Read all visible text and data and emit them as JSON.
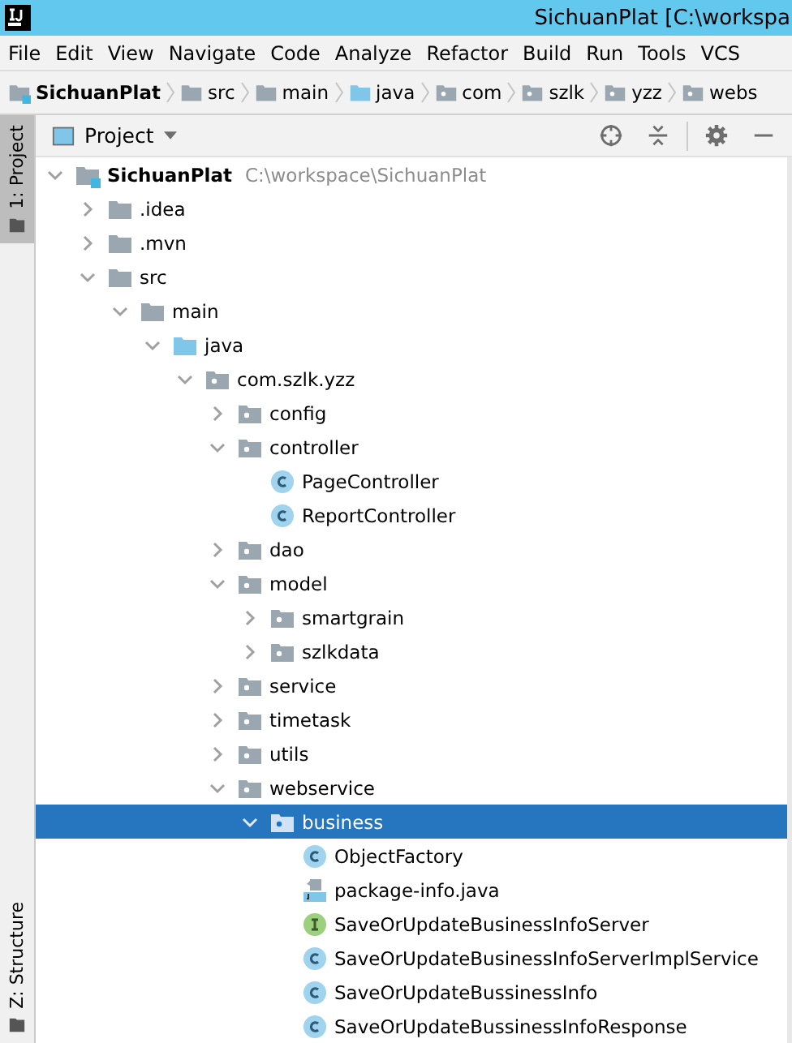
{
  "window": {
    "title": "SichuanPlat [C:\\workspa"
  },
  "menu": [
    "File",
    "Edit",
    "View",
    "Navigate",
    "Code",
    "Analyze",
    "Refactor",
    "Build",
    "Run",
    "Tools",
    "VCS"
  ],
  "breadcrumb": [
    {
      "label": "SichuanPlat",
      "kind": "module"
    },
    {
      "label": "src",
      "kind": "folder"
    },
    {
      "label": "main",
      "kind": "folder"
    },
    {
      "label": "java",
      "kind": "source"
    },
    {
      "label": "com",
      "kind": "package"
    },
    {
      "label": "szlk",
      "kind": "package"
    },
    {
      "label": "yzz",
      "kind": "package"
    },
    {
      "label": "webs",
      "kind": "package"
    }
  ],
  "side_tabs": [
    {
      "label": "1: Project",
      "selected": true
    },
    {
      "label": "Z: Structure",
      "selected": false
    }
  ],
  "panel": {
    "title": "Project"
  },
  "tree": [
    {
      "label": "SichuanPlat",
      "path": "C:\\workspace\\SichuanPlat",
      "kind": "module",
      "expanded": true,
      "selected": false,
      "children": [
        {
          "label": ".idea",
          "kind": "folder",
          "expanded": false,
          "selected": false
        },
        {
          "label": ".mvn",
          "kind": "folder",
          "expanded": false,
          "selected": false
        },
        {
          "label": "src",
          "kind": "folder",
          "expanded": true,
          "selected": false,
          "children": [
            {
              "label": "main",
              "kind": "folder",
              "expanded": true,
              "selected": false,
              "children": [
                {
                  "label": "java",
                  "kind": "source",
                  "expanded": true,
                  "selected": false,
                  "children": [
                    {
                      "label": "com.szlk.yzz",
                      "kind": "package",
                      "expanded": true,
                      "selected": false,
                      "children": [
                        {
                          "label": "config",
                          "kind": "package",
                          "expanded": false,
                          "selected": false
                        },
                        {
                          "label": "controller",
                          "kind": "package",
                          "expanded": true,
                          "selected": false,
                          "children": [
                            {
                              "label": "PageController",
                              "kind": "class",
                              "selected": false
                            },
                            {
                              "label": "ReportController",
                              "kind": "class",
                              "selected": false
                            }
                          ]
                        },
                        {
                          "label": "dao",
                          "kind": "package",
                          "expanded": false,
                          "selected": false
                        },
                        {
                          "label": "model",
                          "kind": "package",
                          "expanded": true,
                          "selected": false,
                          "children": [
                            {
                              "label": "smartgrain",
                              "kind": "package",
                              "expanded": false,
                              "selected": false
                            },
                            {
                              "label": "szlkdata",
                              "kind": "package",
                              "expanded": false,
                              "selected": false
                            }
                          ]
                        },
                        {
                          "label": "service",
                          "kind": "package",
                          "expanded": false,
                          "selected": false
                        },
                        {
                          "label": "timetask",
                          "kind": "package",
                          "expanded": false,
                          "selected": false
                        },
                        {
                          "label": "utils",
                          "kind": "package",
                          "expanded": false,
                          "selected": false
                        },
                        {
                          "label": "webservice",
                          "kind": "package",
                          "expanded": true,
                          "selected": false,
                          "children": [
                            {
                              "label": "business",
                              "kind": "package",
                              "expanded": true,
                              "selected": true,
                              "children": [
                                {
                                  "label": "ObjectFactory",
                                  "kind": "class",
                                  "selected": false
                                },
                                {
                                  "label": "package-info.java",
                                  "kind": "javafile",
                                  "selected": false
                                },
                                {
                                  "label": "SaveOrUpdateBusinessInfoServer",
                                  "kind": "interface",
                                  "selected": false
                                },
                                {
                                  "label": "SaveOrUpdateBusinessInfoServerImplService",
                                  "kind": "class",
                                  "selected": false
                                },
                                {
                                  "label": "SaveOrUpdateBussinessInfo",
                                  "kind": "class",
                                  "selected": false
                                },
                                {
                                  "label": "SaveOrUpdateBussinessInfoResponse",
                                  "kind": "class",
                                  "selected": false
                                }
                              ]
                            }
                          ]
                        }
                      ]
                    }
                  ]
                }
              ]
            }
          ]
        }
      ]
    }
  ]
}
